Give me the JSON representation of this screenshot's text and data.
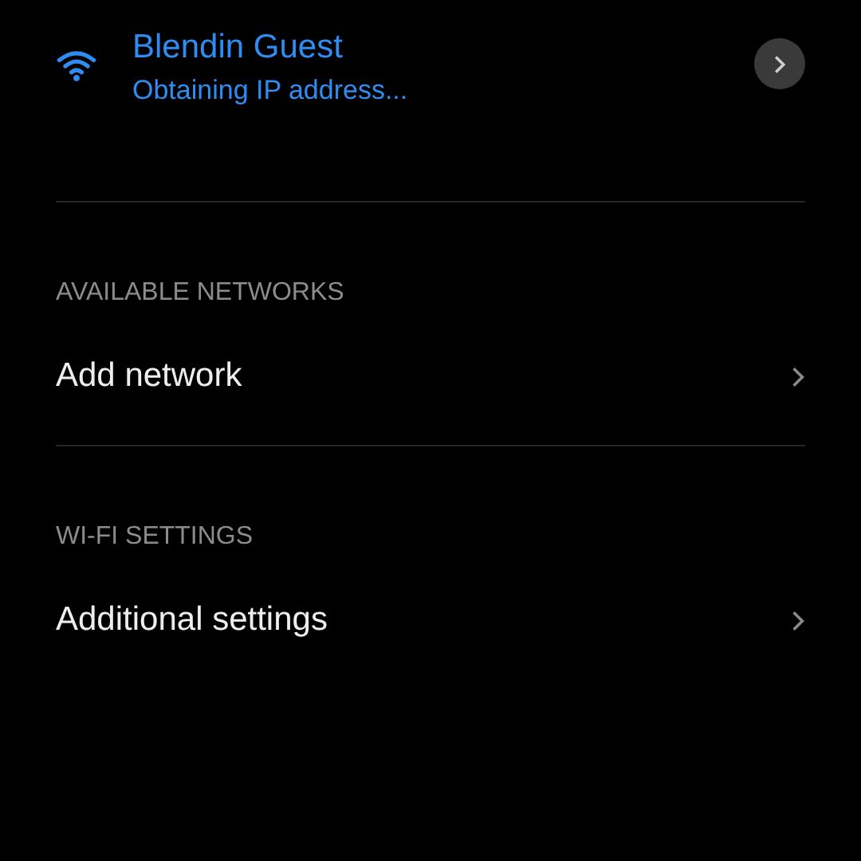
{
  "current_network": {
    "name": "Blendin Guest",
    "status": "Obtaining IP address..."
  },
  "sections": [
    {
      "header": "AVAILABLE NETWORKS",
      "items": [
        {
          "label": "Add network"
        }
      ]
    },
    {
      "header": "WI-FI SETTINGS",
      "items": [
        {
          "label": "Additional settings"
        }
      ]
    }
  ]
}
